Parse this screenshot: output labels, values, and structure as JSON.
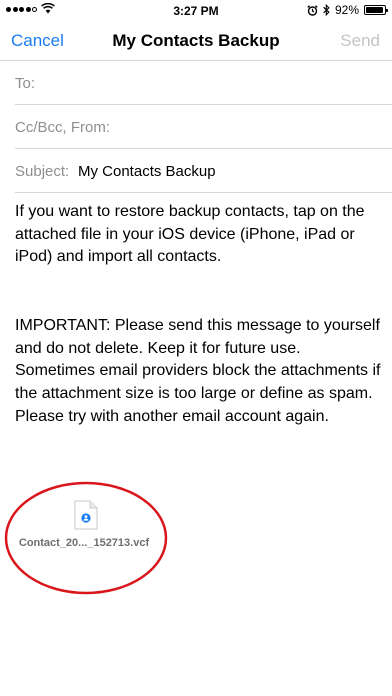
{
  "status_bar": {
    "time": "3:27 PM",
    "battery_percent": "92%",
    "battery_level": 0.92,
    "icons": [
      "signal-dots",
      "wifi-icon",
      "alarm-icon",
      "bluetooth-icon",
      "battery-icon"
    ]
  },
  "nav": {
    "cancel_label": "Cancel",
    "title": "My Contacts Backup",
    "send_label": "Send",
    "accent_color": "#1a7cf4",
    "disabled_color": "#c4c4c8"
  },
  "fields": {
    "to_label": "To:",
    "ccbcc_label": "Cc/Bcc, From:",
    "subject_label": "Subject:",
    "subject_value": "My Contacts Backup"
  },
  "body": {
    "paragraph1": "If you want to restore backup contacts, tap on the attached file in your iOS device (iPhone, iPad or iPod) and import all contacts.",
    "paragraph2": "IMPORTANT: Please send this message to yourself and do not delete. Keep it for future use. Sometimes email providers block the attachments if the attachment size is too large or define as spam. Please try with another email account again."
  },
  "attachment": {
    "file_name": "Contact_20..._152713.vcf",
    "icon": "vcard-file-icon",
    "highlight_color": "#d9161c"
  }
}
